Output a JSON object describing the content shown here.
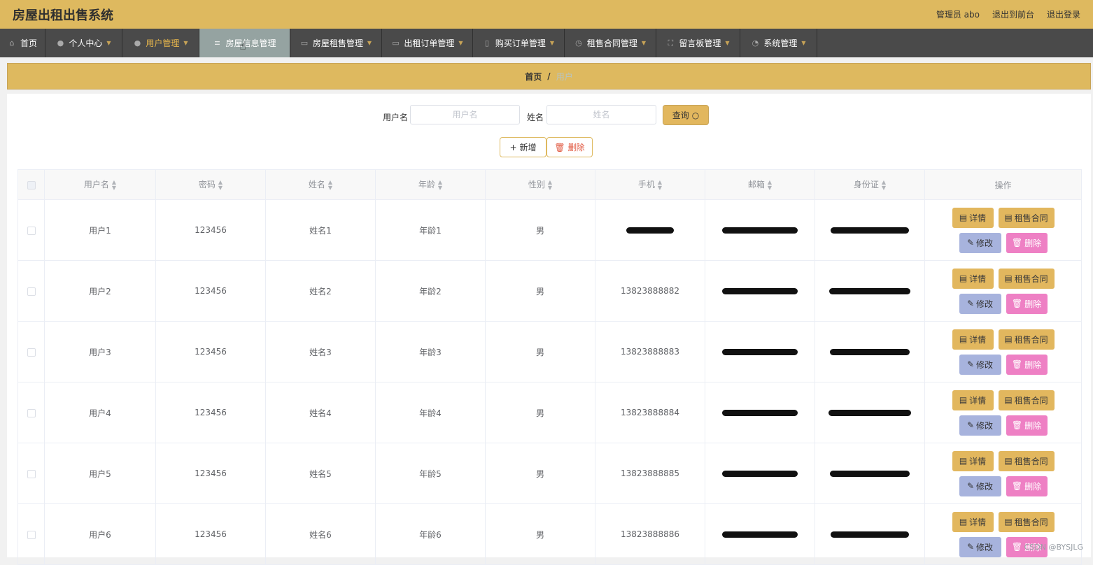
{
  "header": {
    "title": "房屋出租出售系统",
    "admin_label": "管理员 abo",
    "to_frontend": "退出到前台",
    "logout": "退出登录"
  },
  "nav": [
    {
      "label": "首页",
      "icon": "home-icon"
    },
    {
      "label": "个人中心",
      "icon": "person-icon"
    },
    {
      "label": "用户管理",
      "icon": "person-icon"
    },
    {
      "label": "房屋信息管理",
      "icon": "list-icon"
    },
    {
      "label": "房屋租售管理",
      "icon": "chat-icon"
    },
    {
      "label": "出租订单管理",
      "icon": "chat-icon"
    },
    {
      "label": "购买订单管理",
      "icon": "phone-icon"
    },
    {
      "label": "租售合同管理",
      "icon": "compass-icon"
    },
    {
      "label": "留言板管理",
      "icon": "fullscreen-icon"
    },
    {
      "label": "系统管理",
      "icon": "clock-icon"
    }
  ],
  "breadcrumb": {
    "home": "首页",
    "sep": "/",
    "current": "用户"
  },
  "search": {
    "username_label": "用户名",
    "username_placeholder": "用户名",
    "name_label": "姓名",
    "name_placeholder": "姓名",
    "query_button": "查询"
  },
  "actions": {
    "add": "新增",
    "delete": "删除"
  },
  "table": {
    "headers": [
      "用户名",
      "密码",
      "姓名",
      "年龄",
      "性别",
      "手机",
      "邮箱",
      "身份证",
      "操作"
    ],
    "rows": [
      {
        "username": "用户1",
        "password": "123456",
        "name": "姓名1",
        "age": "年龄1",
        "gender": "男",
        "phone": ""
      },
      {
        "username": "用户2",
        "password": "123456",
        "name": "姓名2",
        "age": "年龄2",
        "gender": "男",
        "phone": "13823888882"
      },
      {
        "username": "用户3",
        "password": "123456",
        "name": "姓名3",
        "age": "年龄3",
        "gender": "男",
        "phone": "13823888883"
      },
      {
        "username": "用户4",
        "password": "123456",
        "name": "姓名4",
        "age": "年龄4",
        "gender": "男",
        "phone": "13823888884"
      },
      {
        "username": "用户5",
        "password": "123456",
        "name": "姓名5",
        "age": "年龄5",
        "gender": "男",
        "phone": "13823888885"
      },
      {
        "username": "用户6",
        "password": "123456",
        "name": "姓名6",
        "age": "年龄6",
        "gender": "男",
        "phone": "13823888886"
      }
    ],
    "row_actions": {
      "detail": "详情",
      "contract": "租售合同",
      "edit": "修改",
      "remove": "删除"
    }
  },
  "watermark": "CSDN @BYSJLG",
  "colors": {
    "accent": "#deb95f",
    "nav_bg": "#4a4a4a",
    "edit": "#a7b3dd",
    "remove": "#ee80c4"
  }
}
